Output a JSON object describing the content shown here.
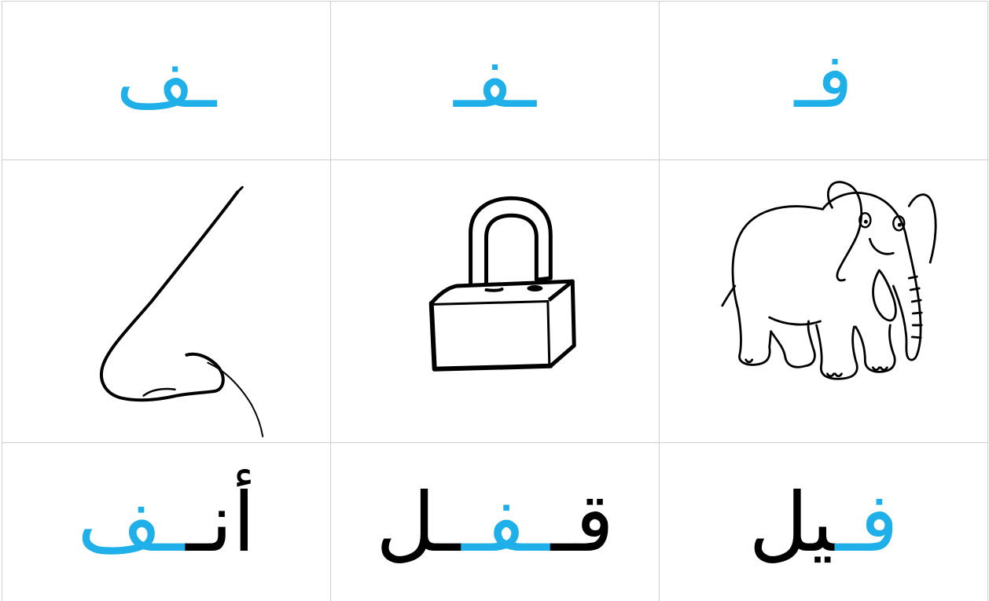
{
  "colors": {
    "accent": "#1fb0ea",
    "text": "#000000",
    "grid_line": "#cfcfcf",
    "background": "#ffffff"
  },
  "letters": {
    "initial": "فـ",
    "medial": "ـفـ",
    "final": "ـف"
  },
  "pictures": {
    "elephant": "elephant-drawing",
    "lock": "padlock-drawing",
    "nose": "nose-drawing"
  },
  "words": {
    "elephant": {
      "accent_part": "فـ",
      "rest": "يل"
    },
    "lock": {
      "before": "قـ",
      "accent_part": "ـفـ",
      "after": "ـل"
    },
    "nose": {
      "rest": "أنـ",
      "accent_part": "ـف"
    }
  }
}
